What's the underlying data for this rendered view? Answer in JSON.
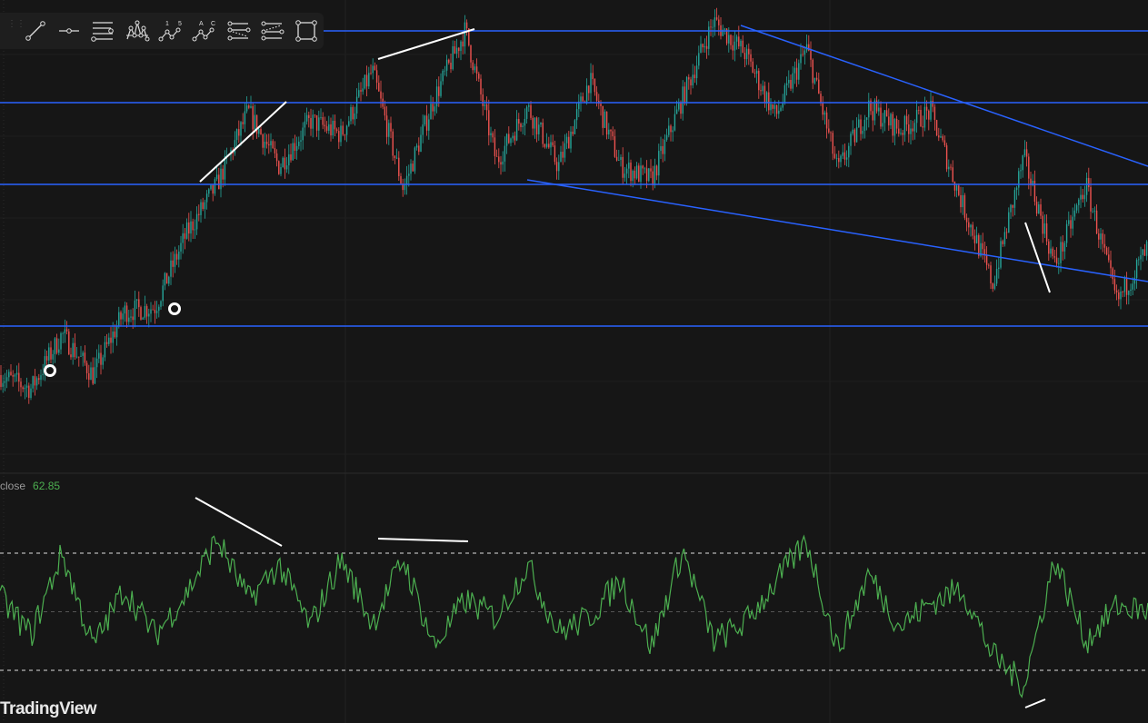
{
  "toolbar": {
    "tools": [
      {
        "name": "trend-line-icon"
      },
      {
        "name": "horizontal-ray-icon"
      },
      {
        "name": "parallel-channel-icon"
      },
      {
        "name": "head-and-shoulders-icon"
      },
      {
        "name": "elliott-impulse-wave-icon",
        "labels": [
          "1",
          "5"
        ]
      },
      {
        "name": "elliott-correction-wave-icon",
        "labels": [
          "A",
          "C"
        ]
      },
      {
        "name": "regression-trend-icon"
      },
      {
        "name": "flat-top-bottom-icon"
      },
      {
        "name": "rectangle-icon"
      }
    ]
  },
  "indicator": {
    "label": "close",
    "value": "62.85"
  },
  "brand": {
    "logo_text": "TradingView"
  },
  "colors": {
    "background": "#161616",
    "up": "#26a69a",
    "down": "#ef5350",
    "level_line": "#2962ff",
    "rsi": "#4caf50",
    "drawing": "#ffffff"
  },
  "chart_data": {
    "type": "candlestick",
    "price_path": [
      52.5,
      51,
      57,
      52.5,
      59.5,
      60,
      68,
      73.5,
      81.5,
      75.5,
      80.5,
      79,
      86,
      73,
      83,
      90.5,
      76,
      82,
      75.5,
      85,
      75.5,
      74,
      83,
      91.5,
      88,
      81,
      88.5,
      75,
      82,
      79.5,
      81.5,
      71.5,
      62.5,
      76.5,
      64.5,
      73.5,
      60.5,
      66.5
    ],
    "horizontal_levels": [
      90.4,
      82.5,
      73.5,
      57.9
    ],
    "rsi": {
      "levels": [
        70,
        50,
        30
      ],
      "path": [
        55,
        42,
        70,
        38,
        58,
        42,
        56,
        75,
        54,
        66,
        45,
        68,
        46,
        68,
        38,
        54,
        48,
        66,
        43,
        48,
        61,
        38,
        71,
        40,
        46,
        60,
        74,
        37,
        63,
        45,
        53,
        58,
        35,
        25,
        68,
        40,
        52,
        50
      ]
    }
  }
}
